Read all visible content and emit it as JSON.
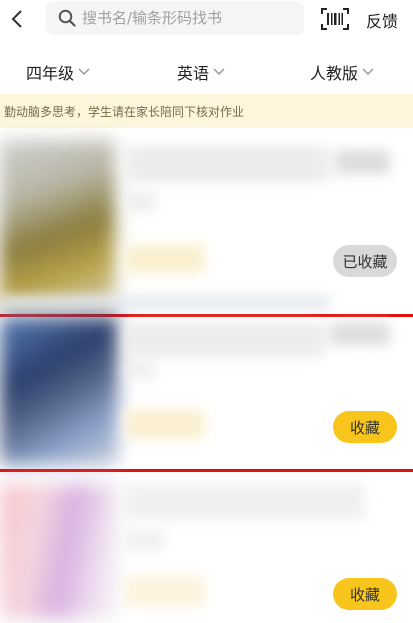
{
  "header": {
    "search_placeholder": "搜书名/输条形码找书",
    "feedback_label": "反馈"
  },
  "filters": {
    "grade": "四年级",
    "subject": "英语",
    "edition": "人教版"
  },
  "notice": {
    "text": "勤动脑多思考，学生请在家长陪同下核对作业"
  },
  "books": [
    {
      "favorite_label": "已收藏",
      "favorited": true
    },
    {
      "favorite_label": "收藏",
      "favorited": false
    },
    {
      "favorite_label": "收藏",
      "favorited": false
    }
  ],
  "colors": {
    "accent": "#f8c51c",
    "highlight_line": "#e01010",
    "notice_bg": "#fdf6dd"
  }
}
